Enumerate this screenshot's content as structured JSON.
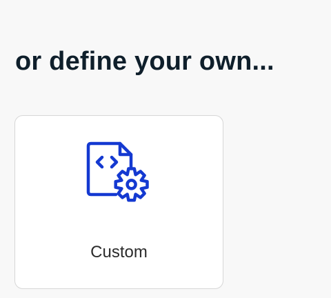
{
  "section": {
    "heading": "or define your own..."
  },
  "custom_card": {
    "label": "Custom",
    "icon": "custom-file-gear-icon",
    "accent_color": "#1439d1"
  }
}
